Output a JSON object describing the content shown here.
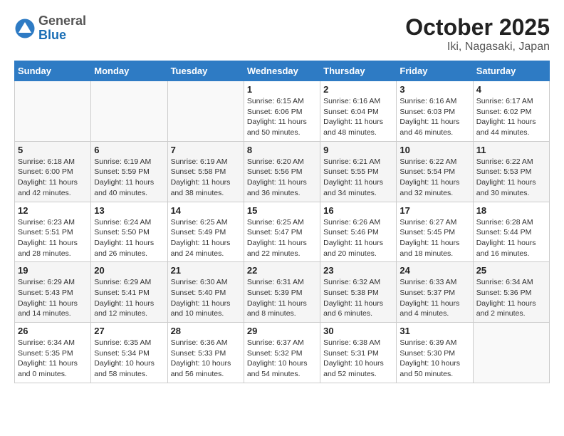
{
  "header": {
    "logo_general": "General",
    "logo_blue": "Blue",
    "title": "October 2025",
    "subtitle": "Iki, Nagasaki, Japan"
  },
  "weekdays": [
    "Sunday",
    "Monday",
    "Tuesday",
    "Wednesday",
    "Thursday",
    "Friday",
    "Saturday"
  ],
  "weeks": [
    [
      {
        "day": "",
        "info": ""
      },
      {
        "day": "",
        "info": ""
      },
      {
        "day": "",
        "info": ""
      },
      {
        "day": "1",
        "info": "Sunrise: 6:15 AM\nSunset: 6:06 PM\nDaylight: 11 hours\nand 50 minutes."
      },
      {
        "day": "2",
        "info": "Sunrise: 6:16 AM\nSunset: 6:04 PM\nDaylight: 11 hours\nand 48 minutes."
      },
      {
        "day": "3",
        "info": "Sunrise: 6:16 AM\nSunset: 6:03 PM\nDaylight: 11 hours\nand 46 minutes."
      },
      {
        "day": "4",
        "info": "Sunrise: 6:17 AM\nSunset: 6:02 PM\nDaylight: 11 hours\nand 44 minutes."
      }
    ],
    [
      {
        "day": "5",
        "info": "Sunrise: 6:18 AM\nSunset: 6:00 PM\nDaylight: 11 hours\nand 42 minutes."
      },
      {
        "day": "6",
        "info": "Sunrise: 6:19 AM\nSunset: 5:59 PM\nDaylight: 11 hours\nand 40 minutes."
      },
      {
        "day": "7",
        "info": "Sunrise: 6:19 AM\nSunset: 5:58 PM\nDaylight: 11 hours\nand 38 minutes."
      },
      {
        "day": "8",
        "info": "Sunrise: 6:20 AM\nSunset: 5:56 PM\nDaylight: 11 hours\nand 36 minutes."
      },
      {
        "day": "9",
        "info": "Sunrise: 6:21 AM\nSunset: 5:55 PM\nDaylight: 11 hours\nand 34 minutes."
      },
      {
        "day": "10",
        "info": "Sunrise: 6:22 AM\nSunset: 5:54 PM\nDaylight: 11 hours\nand 32 minutes."
      },
      {
        "day": "11",
        "info": "Sunrise: 6:22 AM\nSunset: 5:53 PM\nDaylight: 11 hours\nand 30 minutes."
      }
    ],
    [
      {
        "day": "12",
        "info": "Sunrise: 6:23 AM\nSunset: 5:51 PM\nDaylight: 11 hours\nand 28 minutes."
      },
      {
        "day": "13",
        "info": "Sunrise: 6:24 AM\nSunset: 5:50 PM\nDaylight: 11 hours\nand 26 minutes."
      },
      {
        "day": "14",
        "info": "Sunrise: 6:25 AM\nSunset: 5:49 PM\nDaylight: 11 hours\nand 24 minutes."
      },
      {
        "day": "15",
        "info": "Sunrise: 6:25 AM\nSunset: 5:47 PM\nDaylight: 11 hours\nand 22 minutes."
      },
      {
        "day": "16",
        "info": "Sunrise: 6:26 AM\nSunset: 5:46 PM\nDaylight: 11 hours\nand 20 minutes."
      },
      {
        "day": "17",
        "info": "Sunrise: 6:27 AM\nSunset: 5:45 PM\nDaylight: 11 hours\nand 18 minutes."
      },
      {
        "day": "18",
        "info": "Sunrise: 6:28 AM\nSunset: 5:44 PM\nDaylight: 11 hours\nand 16 minutes."
      }
    ],
    [
      {
        "day": "19",
        "info": "Sunrise: 6:29 AM\nSunset: 5:43 PM\nDaylight: 11 hours\nand 14 minutes."
      },
      {
        "day": "20",
        "info": "Sunrise: 6:29 AM\nSunset: 5:41 PM\nDaylight: 11 hours\nand 12 minutes."
      },
      {
        "day": "21",
        "info": "Sunrise: 6:30 AM\nSunset: 5:40 PM\nDaylight: 11 hours\nand 10 minutes."
      },
      {
        "day": "22",
        "info": "Sunrise: 6:31 AM\nSunset: 5:39 PM\nDaylight: 11 hours\nand 8 minutes."
      },
      {
        "day": "23",
        "info": "Sunrise: 6:32 AM\nSunset: 5:38 PM\nDaylight: 11 hours\nand 6 minutes."
      },
      {
        "day": "24",
        "info": "Sunrise: 6:33 AM\nSunset: 5:37 PM\nDaylight: 11 hours\nand 4 minutes."
      },
      {
        "day": "25",
        "info": "Sunrise: 6:34 AM\nSunset: 5:36 PM\nDaylight: 11 hours\nand 2 minutes."
      }
    ],
    [
      {
        "day": "26",
        "info": "Sunrise: 6:34 AM\nSunset: 5:35 PM\nDaylight: 11 hours\nand 0 minutes."
      },
      {
        "day": "27",
        "info": "Sunrise: 6:35 AM\nSunset: 5:34 PM\nDaylight: 10 hours\nand 58 minutes."
      },
      {
        "day": "28",
        "info": "Sunrise: 6:36 AM\nSunset: 5:33 PM\nDaylight: 10 hours\nand 56 minutes."
      },
      {
        "day": "29",
        "info": "Sunrise: 6:37 AM\nSunset: 5:32 PM\nDaylight: 10 hours\nand 54 minutes."
      },
      {
        "day": "30",
        "info": "Sunrise: 6:38 AM\nSunset: 5:31 PM\nDaylight: 10 hours\nand 52 minutes."
      },
      {
        "day": "31",
        "info": "Sunrise: 6:39 AM\nSunset: 5:30 PM\nDaylight: 10 hours\nand 50 minutes."
      },
      {
        "day": "",
        "info": ""
      }
    ]
  ]
}
